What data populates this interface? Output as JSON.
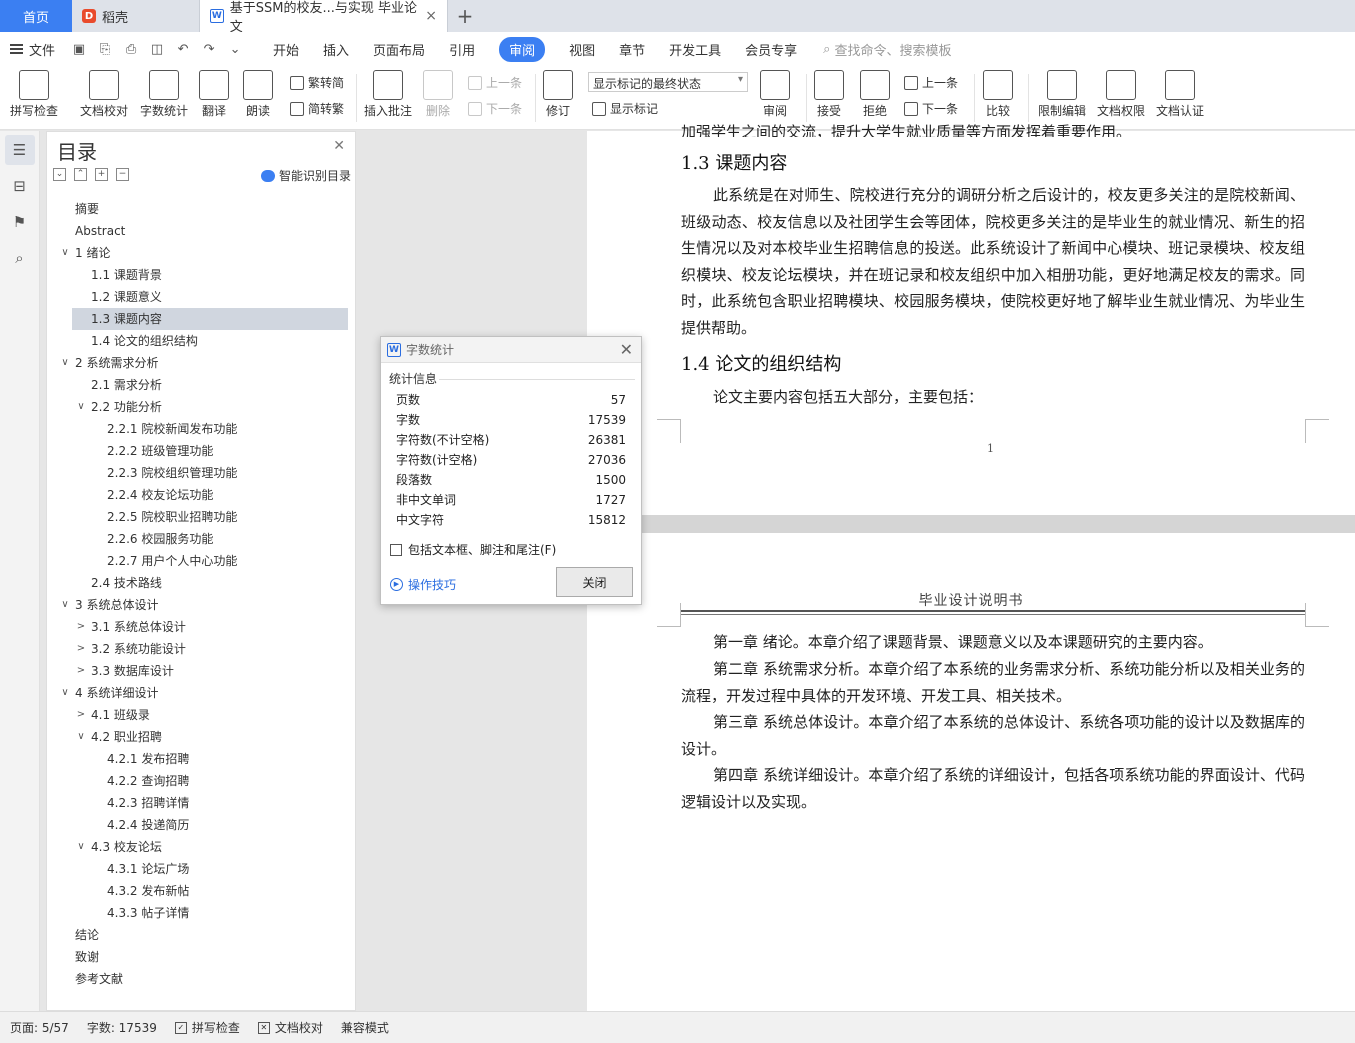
{
  "tabs": {
    "home": "首页",
    "daoke": "稻壳",
    "doc_title": "基于SSM的校友...与实现 毕业论文",
    "close": "×",
    "add": "+"
  },
  "menu": {
    "file": "文件",
    "items": [
      "开始",
      "插入",
      "页面布局",
      "引用",
      "审阅",
      "视图",
      "章节",
      "开发工具",
      "会员专享"
    ],
    "active_index": 4,
    "search_placeholder": "查找命令、搜索模板"
  },
  "ribbon": {
    "spellcheck": "拼写检查",
    "doc_check": "文档校对",
    "word_count": "字数统计",
    "translate": "翻译",
    "read_aloud": "朗读",
    "trad_to_simp": "繁转简",
    "simp_to_trad": "简转繁",
    "insert_comment": "插入批注",
    "delete": "删除",
    "prev_comment": "上一条",
    "next_comment": "下一条",
    "revise": "修订",
    "display_state": "显示标记的最终状态",
    "show_markup": "显示标记",
    "review": "审阅",
    "accept": "接受",
    "reject": "拒绝",
    "prev_change": "上一条",
    "next_change": "下一条",
    "compare": "比较",
    "restrict_edit": "限制编辑",
    "doc_permission": "文档权限",
    "doc_cert": "文档认证"
  },
  "toc": {
    "title": "目录",
    "smart": "智能识别目录",
    "items": [
      {
        "text": "摘要",
        "level": 0,
        "arrow": ""
      },
      {
        "text": "Abstract",
        "level": 0,
        "arrow": ""
      },
      {
        "text": "1  绪论",
        "level": 0,
        "arrow": "v"
      },
      {
        "text": "1.1  课题背景",
        "level": 1,
        "arrow": ""
      },
      {
        "text": "1.2  课题意义",
        "level": 1,
        "arrow": ""
      },
      {
        "text": "1.3  课题内容",
        "level": 1,
        "arrow": "",
        "selected": true
      },
      {
        "text": "1.4  论文的组织结构",
        "level": 1,
        "arrow": ""
      },
      {
        "text": "2  系统需求分析",
        "level": 0,
        "arrow": "v"
      },
      {
        "text": "2.1  需求分析",
        "level": 1,
        "arrow": ""
      },
      {
        "text": "2.2  功能分析",
        "level": 1,
        "arrow": "v"
      },
      {
        "text": "2.2.1  院校新闻发布功能",
        "level": 2,
        "arrow": ""
      },
      {
        "text": "2.2.2  班级管理功能",
        "level": 2,
        "arrow": ""
      },
      {
        "text": "2.2.3  院校组织管理功能",
        "level": 2,
        "arrow": ""
      },
      {
        "text": "2.2.4  校友论坛功能",
        "level": 2,
        "arrow": ""
      },
      {
        "text": "2.2.5  院校职业招聘功能",
        "level": 2,
        "arrow": ""
      },
      {
        "text": "2.2.6  校园服务功能",
        "level": 2,
        "arrow": ""
      },
      {
        "text": "2.2.7  用户个人中心功能",
        "level": 2,
        "arrow": ""
      },
      {
        "text": "2.4  技术路线",
        "level": 1,
        "arrow": ""
      },
      {
        "text": "3  系统总体设计",
        "level": 0,
        "arrow": "v"
      },
      {
        "text": "3.1  系统总体设计",
        "level": 1,
        "arrow": ">"
      },
      {
        "text": "3.2  系统功能设计",
        "level": 1,
        "arrow": ">"
      },
      {
        "text": "3.3  数据库设计",
        "level": 1,
        "arrow": ">"
      },
      {
        "text": "4  系统详细设计",
        "level": 0,
        "arrow": "v"
      },
      {
        "text": "4.1  班级录",
        "level": 1,
        "arrow": ">"
      },
      {
        "text": "4.2  职业招聘",
        "level": 1,
        "arrow": "v"
      },
      {
        "text": "4.2.1  发布招聘",
        "level": 2,
        "arrow": ""
      },
      {
        "text": "4.2.2  查询招聘",
        "level": 2,
        "arrow": ""
      },
      {
        "text": "4.2.3  招聘详情",
        "level": 2,
        "arrow": ""
      },
      {
        "text": "4.2.4  投递简历",
        "level": 2,
        "arrow": ""
      },
      {
        "text": "4.3  校友论坛",
        "level": 1,
        "arrow": "v"
      },
      {
        "text": "4.3.1  论坛广场",
        "level": 2,
        "arrow": ""
      },
      {
        "text": "4.3.2  发布新帖",
        "level": 2,
        "arrow": ""
      },
      {
        "text": "4.3.3  帖子详情",
        "level": 2,
        "arrow": ""
      },
      {
        "text": "结论",
        "level": 0,
        "arrow": ""
      },
      {
        "text": "致谢",
        "level": 0,
        "arrow": ""
      },
      {
        "text": "参考文献",
        "level": 0,
        "arrow": ""
      }
    ]
  },
  "document": {
    "cut_line": "加强学生之间的交流，提升大学生就业质量等方面发挥着重要作用。",
    "h_13": "1.3  课题内容",
    "p_13": "此系统是在对师生、院校进行充分的调研分析之后设计的，校友更多关注的是院校新闻、班级动态、校友信息以及社团学生会等团体，院校更多关注的是毕业生的就业情况、新生的招生情况以及对本校毕业生招聘信息的投送。此系统设计了新闻中心模块、班记录模块、校友组织模块、校友论坛模块，并在班记录和校友组织中加入相册功能，更好地满足校友的需求。同时，此系统包含职业招聘模块、校园服务模块，使院校更好地了解毕业生就业情况、为毕业生提供帮助。",
    "h_14": "1.4  论文的组织结构",
    "p_14": "论文主要内容包括五大部分，主要包括：",
    "page_number": "1",
    "header": "毕业设计说明书",
    "p2_1": "第一章  绪论。本章介绍了课题背景、课题意义以及本课题研究的主要内容。",
    "p2_2": "第二章  系统需求分析。本章介绍了本系统的业务需求分析、系统功能分析以及相关业务的流程，开发过程中具体的开发环境、开发工具、相关技术。",
    "p2_3": "第三章  系统总体设计。本章介绍了本系统的总体设计、系统各项功能的设计以及数据库的设计。",
    "p2_4": "第四章  系统详细设计。本章介绍了系统的详细设计，包括各项系统功能的界面设计、代码逻辑设计以及实现。"
  },
  "dialog": {
    "title": "字数统计",
    "section": "统计信息",
    "rows": [
      {
        "label": "页数",
        "value": "57"
      },
      {
        "label": "字数",
        "value": "17539"
      },
      {
        "label": "字符数(不计空格)",
        "value": "26381"
      },
      {
        "label": "字符数(计空格)",
        "value": "27036"
      },
      {
        "label": "段落数",
        "value": "1500"
      },
      {
        "label": "非中文单词",
        "value": "1727"
      },
      {
        "label": "中文字符",
        "value": "15812"
      }
    ],
    "include_label": "包括文本框、脚注和尾注(F)",
    "tips": "操作技巧",
    "close_button": "关闭"
  },
  "status": {
    "page": "页面: 5/57",
    "words": "字数: 17539",
    "spell": "拼写检查",
    "proof": "文档校对",
    "compat": "兼容模式"
  },
  "colors": {
    "accent": "#3b7ff2",
    "selected_toc": "#d0d6df"
  }
}
